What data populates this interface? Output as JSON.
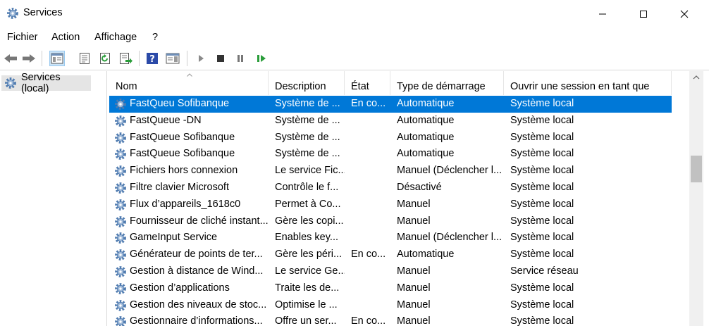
{
  "window": {
    "title": "Services",
    "icon": "services-gear-icon"
  },
  "menu": [
    "Fichier",
    "Action",
    "Affichage",
    "?"
  ],
  "toolbar": {
    "icons": [
      "back-arrow-icon",
      "forward-arrow-icon",
      "show-hide-console-tree-icon",
      "properties-icon",
      "refresh-icon",
      "export-list-icon",
      "help-icon",
      "show-hide-action-pane-icon",
      "start-service-icon",
      "stop-service-icon",
      "pause-service-icon",
      "restart-service-icon"
    ]
  },
  "tree": {
    "root_label": "Services (local)"
  },
  "columns": [
    "Nom",
    "Description",
    "État",
    "Type de démarrage",
    "Ouvrir une session en tant que"
  ],
  "rows": [
    {
      "name": "FastQueu Sofibanque",
      "desc": "Système de ...",
      "state": "En co...",
      "startup": "Automatique",
      "logon": "Système local",
      "selected": true
    },
    {
      "name": "FastQueue -DN",
      "desc": "Système de ...",
      "state": "",
      "startup": "Automatique",
      "logon": "Système local"
    },
    {
      "name": "FastQueue Sofibanque",
      "desc": "Système de ...",
      "state": "",
      "startup": "Automatique",
      "logon": "Système local"
    },
    {
      "name": "FastQueue Sofibanque",
      "desc": "Système de ...",
      "state": "",
      "startup": "Automatique",
      "logon": "Système local"
    },
    {
      "name": "Fichiers hors connexion",
      "desc": "Le service Fic...",
      "state": "",
      "startup": "Manuel (Déclencher l...",
      "logon": "Système local"
    },
    {
      "name": "Filtre clavier Microsoft",
      "desc": "Contrôle le f...",
      "state": "",
      "startup": "Désactivé",
      "logon": "Système local"
    },
    {
      "name": "Flux d’appareils_1618c0",
      "desc": "Permet à Co...",
      "state": "",
      "startup": "Manuel",
      "logon": "Système local"
    },
    {
      "name": "Fournisseur de cliché instant...",
      "desc": "Gère les copi...",
      "state": "",
      "startup": "Manuel",
      "logon": "Système local"
    },
    {
      "name": "GameInput Service",
      "desc": "Enables key...",
      "state": "",
      "startup": "Manuel (Déclencher l...",
      "logon": "Système local"
    },
    {
      "name": "Générateur de points de ter...",
      "desc": "Gère les péri...",
      "state": "En co...",
      "startup": "Automatique",
      "logon": "Système local"
    },
    {
      "name": "Gestion à distance de Wind...",
      "desc": "Le service Ge...",
      "state": "",
      "startup": "Manuel",
      "logon": "Service réseau"
    },
    {
      "name": "Gestion d’applications",
      "desc": "Traite les de...",
      "state": "",
      "startup": "Manuel",
      "logon": "Système local"
    },
    {
      "name": "Gestion des niveaux de stoc...",
      "desc": "Optimise le ...",
      "state": "",
      "startup": "Manuel",
      "logon": "Système local"
    },
    {
      "name": "Gestionnaire d’informations...",
      "desc": "Offre un ser...",
      "state": "En co...",
      "startup": "Manuel",
      "logon": "Système local"
    }
  ],
  "colors": {
    "selection": "#0078d7",
    "gear": "#4f7bb0",
    "play_green": "#2a9d3a",
    "help_blue": "#2b4aa8"
  }
}
